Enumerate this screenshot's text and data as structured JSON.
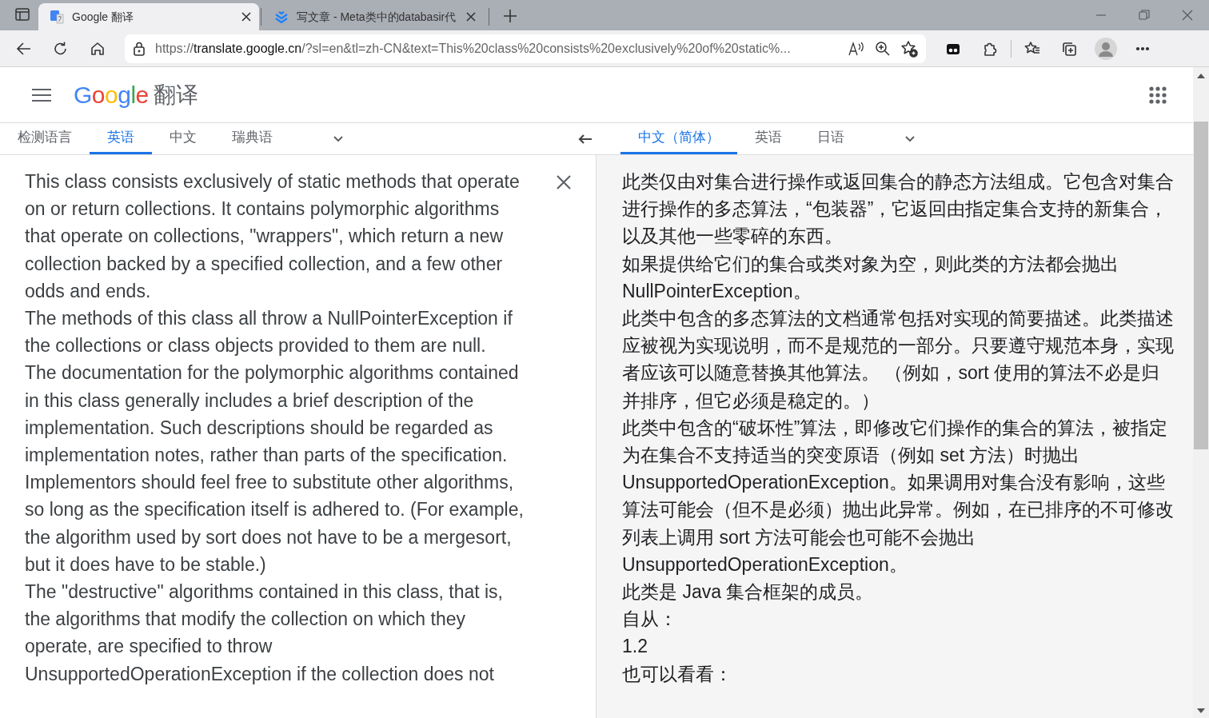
{
  "browser": {
    "tabs": [
      {
        "title": "Google 翻译",
        "selected": true
      },
      {
        "title": "写文章 - Meta类中的databasir代",
        "selected": false
      }
    ],
    "address": {
      "scheme": "https://",
      "host": "translate.google.cn",
      "path": "/?sl=en&tl=zh-CN&text=This%20class%20consists%20exclusively%20of%20static%..."
    }
  },
  "header": {
    "logo": "Google",
    "title": "翻译"
  },
  "source_languages": [
    {
      "label": "检测语言",
      "selected": false
    },
    {
      "label": "英语",
      "selected": true
    },
    {
      "label": "中文",
      "selected": false
    },
    {
      "label": "瑞典语",
      "selected": false
    }
  ],
  "target_languages": [
    {
      "label": "中文（简体）",
      "selected": true
    },
    {
      "label": "英语",
      "selected": false
    },
    {
      "label": "日语",
      "selected": false
    }
  ],
  "source_text": [
    "This class consists exclusively of static methods that operate on or return collections. It contains polymorphic algorithms that operate on collections, \"wrappers\", which return a new collection backed by a specified collection, and a few other odds and ends.",
    "The methods of this class all throw a NullPointerException if the collections or class objects provided to them are null.",
    "The documentation for the polymorphic algorithms contained in this class generally includes a brief description of the implementation. Such descriptions should be regarded as implementation notes, rather than parts of the specification. Implementors should feel free to substitute other algorithms, so long as the specification itself is adhered to. (For example, the algorithm used by sort does not have to be a mergesort, but it does have to be stable.)",
    "The \"destructive\" algorithms contained in this class, that is, the algorithms that modify the collection on which they operate, are specified to throw UnsupportedOperationException if the collection does not"
  ],
  "translation": [
    "此类仅由对集合进行操作或返回集合的静态方法组成。它包含对集合进行操作的多态算法，“包装器”，它返回由指定集合支持的新集合，以及其他一些零碎的东西。",
    "如果提供给它们的集合或类对象为空，则此类的方法都会抛出NullPointerException。",
    "此类中包含的多态算法的文档通常包括对实现的简要描述。此类描述应被视为实现说明，而不是规范的一部分。只要遵守规范本身，实现者应该可以随意替换其他算法。 （例如，sort 使用的算法不必是归并排序，但它必须是稳定的。）",
    "此类中包含的“破坏性”算法，即修改它们操作的集合的算法，被指定为在集合不支持适当的突变原语（例如 set 方法）时抛出 UnsupportedOperationException。如果调用对集合没有影响，这些算法可能会（但不是必须）抛出此异常。例如，在已排序的不可修改列表上调用 sort 方法可能会也可能不会抛出 UnsupportedOperationException。",
    "此类是 Java 集合框架的成员。",
    "自从：",
    "1.2",
    "也可以看看："
  ]
}
